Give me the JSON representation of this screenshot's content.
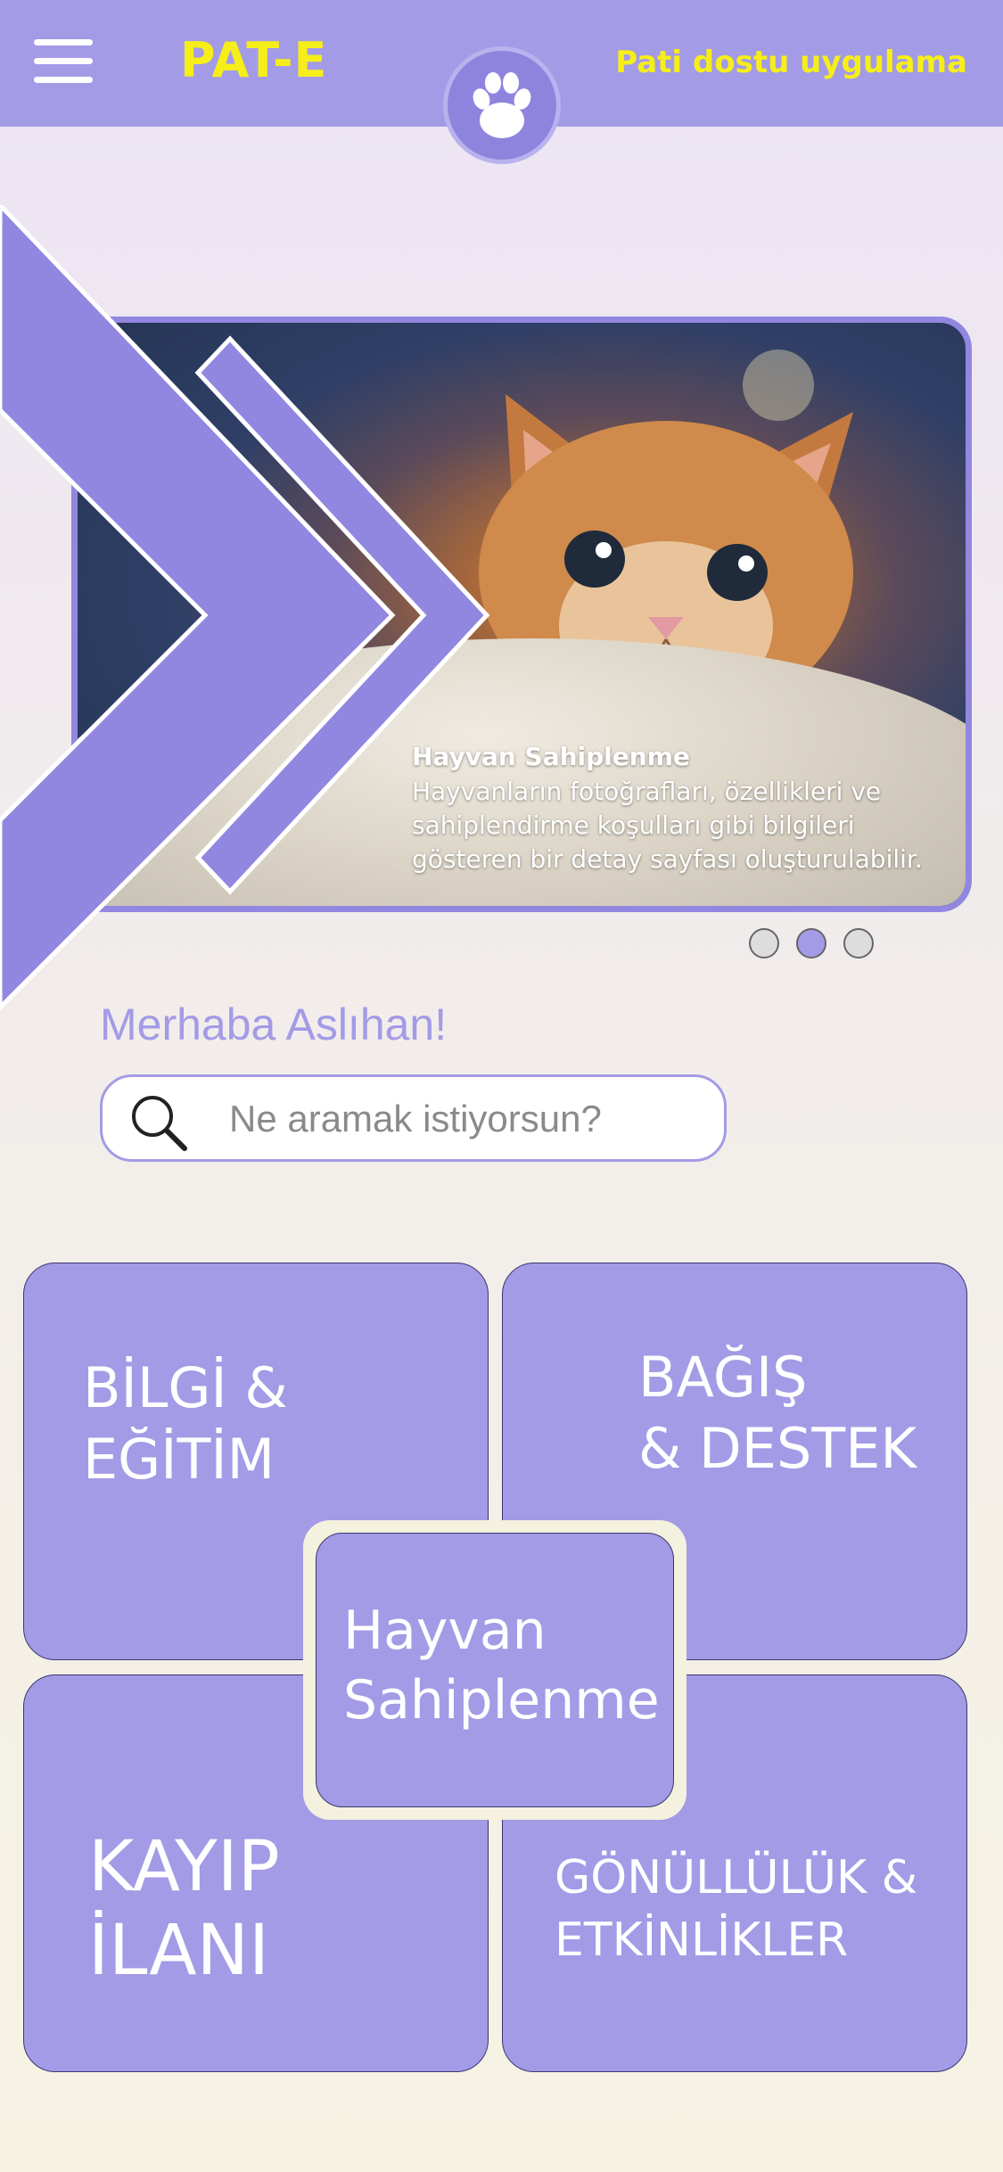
{
  "header": {
    "brand": "PAT-E",
    "tagline": "Pati dostu uygulama",
    "menu_icon": "hamburger-menu-icon",
    "logo_icon": "paw-icon"
  },
  "hero": {
    "title": "Hayvan Sahiplenme",
    "description": "Hayvanların fotoğrafları, özellikleri ve sahiplendirme koşulları gibi bilgileri gösteren bir detay sayfası oluşturulabilir.",
    "active_slide": 2,
    "slide_count": 3
  },
  "greeting": "Merhaba Aslıhan!",
  "search": {
    "placeholder": "Ne aramak istiyorsun?",
    "icon": "search-icon"
  },
  "tiles": {
    "info": {
      "line1": "BİLGİ &",
      "line2": "EĞİTİM"
    },
    "donate": {
      "line1": "BAĞIŞ",
      "line2": "& DESTEK"
    },
    "lost": {
      "line1": "KAYIP",
      "line2": "İLANI"
    },
    "volunteer": {
      "line1": "GÖNÜLLÜLÜK &",
      "line2": "ETKİNLİKLER"
    },
    "adopt": {
      "line1": "Hayvan",
      "line2": "Sahiplenme"
    }
  },
  "colors": {
    "accent": "#a39be6",
    "brand_text": "#f6ee19",
    "tile_text": "#ffffff"
  }
}
